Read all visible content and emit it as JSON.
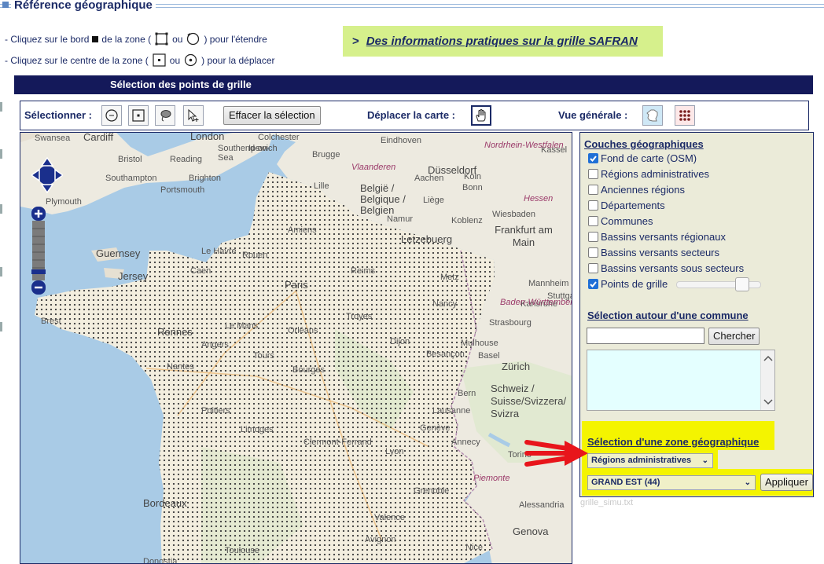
{
  "header": {
    "title": "Référence géographique",
    "instruction_1_pre": "- Cliquez sur le bord",
    "instruction_1_mid": "de la zone (",
    "instruction_1_or": "ou",
    "instruction_1_post": ") pour l'étendre",
    "instruction_2_pre": "- Cliquez sur le centre de la zone (",
    "instruction_2_or": "ou",
    "instruction_2_post": ") pour la déplacer",
    "info_arrow": ">",
    "info_link": "Des informations pratiques sur la grille SAFRAN"
  },
  "panel": {
    "title": "Sélection des points de grille"
  },
  "toolbar": {
    "select_label": "Sélectionner :",
    "clear_label": "Effacer la sélection",
    "move_label": "Déplacer la carte :",
    "overview_label": "Vue générale :"
  },
  "map": {
    "labels": [
      "Swansea",
      "Cardiff",
      "London",
      "Southend-on-Sea",
      "Colchester",
      "Ipswich",
      "Eindhoven",
      "Kassel",
      "Reading",
      "Bristol",
      "Southampton",
      "Brighton",
      "Portsmouth",
      "Plymouth",
      "Brugge",
      "Düsseldorf",
      "Vlaanderen",
      "Nordrhein-Westfalen",
      "Köln",
      "Bonn",
      "Aachen",
      "Lille",
      "België / Belgique / Belgien",
      "Liège",
      "Namur",
      "Hessen",
      "Frankfurt am Main",
      "Wiesbaden",
      "Koblenz",
      "Letzebuerg",
      "Guernsey",
      "Jersey",
      "Le Havre",
      "Rouen",
      "Caen",
      "Amiens",
      "Reims",
      "Paris",
      "Metz",
      "Nancy",
      "Mannheim",
      "Strasbourg",
      "Karlsruhe",
      "Stuttgart",
      "Baden-Württemberg",
      "Brest",
      "Rennes",
      "Le Mans",
      "Orléans",
      "Troyes",
      "Dijon",
      "Besançon",
      "Mulhouse",
      "Basel",
      "Zürich",
      "Nantes",
      "Angers",
      "Tours",
      "Bourges",
      "Schweiz / Suisse/Svizzera/ Svizra",
      "Bern",
      "Lausanne",
      "Genève",
      "Lyon",
      "Annecy",
      "Grenoble",
      "Clermont-Ferrand",
      "Limoges",
      "Poitiers",
      "Torino",
      "Piemonte",
      "Alessandria",
      "Genova",
      "Bordeaux",
      "Valence",
      "Avignon",
      "Nice",
      "Toulouse",
      "Donostia"
    ]
  },
  "side": {
    "layers_title": "Couches géographiques",
    "layers": [
      {
        "label": "Fond de carte (OSM)",
        "checked": true
      },
      {
        "label": "Régions administratives",
        "checked": false
      },
      {
        "label": "Anciennes régions",
        "checked": false
      },
      {
        "label": "Départements",
        "checked": false
      },
      {
        "label": "Communes",
        "checked": false
      },
      {
        "label": "Bassins versants régionaux",
        "checked": false
      },
      {
        "label": "Bassins versants secteurs",
        "checked": false
      },
      {
        "label": "Bassins versants sous secteurs",
        "checked": false
      },
      {
        "label": "Points de grille",
        "checked": true
      }
    ],
    "grid_points_opacity": 0.83,
    "commune_title": "Sélection autour d'une commune",
    "commune_search_value": "",
    "search_button": "Chercher",
    "zone_title": "Sélection d'une zone géographique",
    "zone_type_selected": "Régions administratives",
    "zone_selected": "GRAND EST (44)",
    "apply_button": "Appliquer",
    "footer_text": "grille_simu.txt"
  },
  "colors": {
    "navy": "#14195a",
    "highlight": "#f4f400",
    "info_bg": "#d6f08c",
    "arrow_red": "#e8151b",
    "grid_point": "#3f3f3f"
  }
}
